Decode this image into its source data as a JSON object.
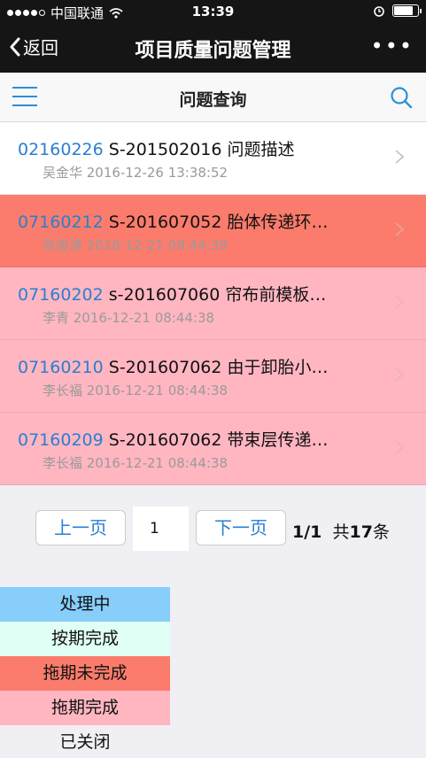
{
  "statusbar": {
    "carrier": "中国联通",
    "time": "13:39"
  },
  "navbar": {
    "back_label": "返回",
    "title": "项目质量问题管理",
    "more_icon": "more-dots-icon"
  },
  "subheader": {
    "title": "问题查询",
    "menu_icon": "hamburger-menu-icon",
    "search_icon": "search-icon"
  },
  "list": {
    "items": [
      {
        "code": "02160226",
        "title": "S-201502016 问题描述",
        "meta": "吴金华 2016-12-26 13:38:52",
        "bg": "#ffffff"
      },
      {
        "code": "07160212",
        "title": "S-201607052 胎体传递环…",
        "meta": "张俊清 2016-12-21 08:44:38",
        "bg": "#fb7c6c"
      },
      {
        "code": "07160202",
        "title": "s-201607060 帘布前模板…",
        "meta": "李青 2016-12-21 08:44:38",
        "bg": "#ffb6c1"
      },
      {
        "code": "07160210",
        "title": "S-201607062 由于卸胎小…",
        "meta": "李长福 2016-12-21 08:44:38",
        "bg": "#ffb6c1"
      },
      {
        "code": "07160209",
        "title": "S-201607062 带束层传递…",
        "meta": "李长福 2016-12-21 08:44:38",
        "bg": "#ffb6c1"
      }
    ]
  },
  "pager": {
    "prev_label": "上一页",
    "page_value": "1",
    "next_label": "下一页",
    "page_info": "1/1",
    "total_prefix": "共",
    "total_count": "17",
    "total_suffix": "条"
  },
  "legend": {
    "items": [
      {
        "label": "处理中",
        "color": "#87cefa"
      },
      {
        "label": "按期完成",
        "color": "#e0fff5"
      },
      {
        "label": "拖期未完成",
        "color": "#fb7c6c"
      },
      {
        "label": "拖期完成",
        "color": "#ffb6c1"
      },
      {
        "label": "已关闭",
        "color": "#efeff4"
      }
    ]
  }
}
